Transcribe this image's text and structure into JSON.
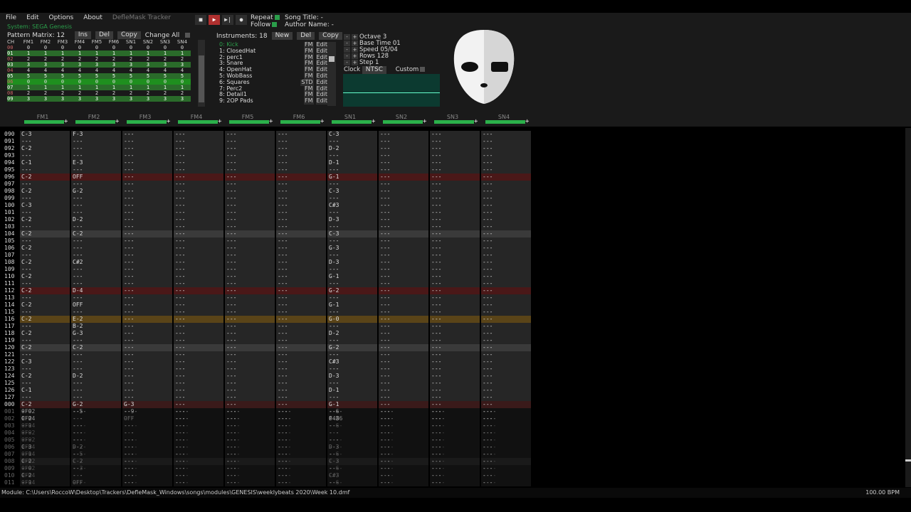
{
  "menu": {
    "items": [
      "File",
      "Edit",
      "Options",
      "About"
    ],
    "app_title": "DefleMask Tracker"
  },
  "system": "System: SEGA Genesis",
  "pattern_matrix": {
    "label": "Pattern Matrix: 12",
    "ins": "Ins",
    "del": "Del",
    "copy": "Copy",
    "change_all": "Change All",
    "channels": [
      "CH",
      "FM1",
      "FM2",
      "FM3",
      "FM4",
      "FM5",
      "FM6",
      "SN1",
      "SN2",
      "SN3",
      "SN4"
    ],
    "rows": [
      [
        "00",
        "0",
        "0",
        "0",
        "0",
        "0",
        "0",
        "0",
        "0",
        "0",
        "0"
      ],
      [
        "01",
        "1",
        "1",
        "1",
        "1",
        "1",
        "1",
        "1",
        "1",
        "1",
        "1"
      ],
      [
        "02",
        "2",
        "2",
        "2",
        "2",
        "2",
        "2",
        "2",
        "2",
        "2",
        "2"
      ],
      [
        "03",
        "3",
        "3",
        "3",
        "3",
        "3",
        "3",
        "3",
        "3",
        "3",
        "3"
      ],
      [
        "04",
        "4",
        "4",
        "4",
        "4",
        "4",
        "4",
        "4",
        "4",
        "4",
        "4"
      ],
      [
        "05",
        "5",
        "5",
        "5",
        "5",
        "5",
        "5",
        "5",
        "5",
        "5",
        "5"
      ],
      [
        "06",
        "0",
        "0",
        "0",
        "0",
        "0",
        "0",
        "0",
        "0",
        "0",
        "0"
      ],
      [
        "07",
        "1",
        "1",
        "1",
        "1",
        "1",
        "1",
        "1",
        "1",
        "1",
        "1"
      ],
      [
        "08",
        "2",
        "2",
        "2",
        "2",
        "2",
        "2",
        "2",
        "2",
        "2",
        "2"
      ],
      [
        "09",
        "3",
        "3",
        "3",
        "3",
        "3",
        "3",
        "3",
        "3",
        "3",
        "3"
      ]
    ]
  },
  "options": {
    "repeat": "Repeat",
    "follow": "Follow"
  },
  "song": {
    "title": "Song Title: -",
    "author": "Author Name: -"
  },
  "instruments": {
    "label": "Instruments: 18",
    "new": "New",
    "del": "Del",
    "copy": "Copy",
    "list": [
      {
        "name": "0: Kick",
        "type": "FM",
        "edit": "Edit"
      },
      {
        "name": "1: ClosedHat",
        "type": "FM",
        "edit": "Edit"
      },
      {
        "name": "2: perc1",
        "type": "FM",
        "edit": "Edit"
      },
      {
        "name": "3: Snare",
        "type": "FM",
        "edit": "Edit"
      },
      {
        "name": "4: OpenHat",
        "type": "FM",
        "edit": "Edit"
      },
      {
        "name": "5: WobBass",
        "type": "FM",
        "edit": "Edit"
      },
      {
        "name": "6: Squares",
        "type": "STD",
        "edit": "Edit"
      },
      {
        "name": "7: Perc2",
        "type": "FM",
        "edit": "Edit"
      },
      {
        "name": "8: Detail1",
        "type": "FM",
        "edit": "Edit"
      },
      {
        "name": "9: 2OP Pads",
        "type": "FM",
        "edit": "Edit"
      }
    ]
  },
  "settings": {
    "octave": "Octave 3",
    "base_time": "Base Time 01",
    "speed": "Speed 05/04",
    "rows": "Rows 128",
    "step": "Step 1",
    "clock": "Clock",
    "ntsc": "NTSC",
    "custom": "Custom"
  },
  "channels": [
    "FM1",
    "FM2",
    "FM3",
    "FM4",
    "FM5",
    "FM6",
    "SN1",
    "SN2",
    "SN3",
    "SN4"
  ],
  "pattern_rows": [
    {
      "r": "090",
      "fm1": "C-3 - 1 0F02",
      "fm2": "F-3 - 7",
      "sn1": "C-3 - 6"
    },
    {
      "r": "091",
      "fm1": "--- - - 0F02",
      "fm2": "",
      "sn1": ""
    },
    {
      "r": "092",
      "fm1": "C-2 - 1 0F04",
      "fm2": "",
      "sn1": "D-2 - 6"
    },
    {
      "r": "093",
      "fm1": "--- - - 0F04",
      "fm2": "",
      "sn1": ""
    },
    {
      "r": "094",
      "fm1": "C-1 - 1 0F02",
      "fm2": "E-3 - 7",
      "sn1": "D-1 - 6"
    },
    {
      "r": "095",
      "fm1": "--- - - 0F02",
      "fm2": "",
      "sn1": ""
    },
    {
      "r": "096",
      "fm1": "C-2 - 0 0F04",
      "fm2": "OFF",
      "sn1": "G-1 - 6",
      "c": "red"
    },
    {
      "r": "097",
      "fm1": "--- - - 0F04",
      "fm2": "",
      "sn1": ""
    },
    {
      "r": "098",
      "fm1": "C-2 - 1 0F02",
      "fm2": "G-2 - 5",
      "sn1": "C-3 - 6"
    },
    {
      "r": "099",
      "fm1": "--- - - 0F02",
      "fm2": "",
      "sn1": ""
    },
    {
      "r": "100",
      "fm1": "C-3 - 1 0F04",
      "fm2": "",
      "sn1": "C#3 - 6"
    },
    {
      "r": "101",
      "fm1": "--- - - 0F04",
      "fm2": "",
      "sn1": ""
    },
    {
      "r": "102",
      "fm1": "C-2 - 1 0F02",
      "fm2": "D-2 - 5",
      "sn1": "D-3 - 6"
    },
    {
      "r": "103",
      "fm1": "--- - - 0F02",
      "fm2": "",
      "sn1": ""
    },
    {
      "r": "104",
      "fm1": "C-2 - 0 0F04",
      "fm2": "C-2 - 3",
      "sn1": "C-3 - 6",
      "c": "gray"
    },
    {
      "r": "105",
      "fm1": "--- - - 0F04",
      "fm2": "",
      "sn1": ""
    },
    {
      "r": "106",
      "fm1": "C-2 - 1 0F02",
      "fm2": "",
      "sn1": "G-3 - 6"
    },
    {
      "r": "107",
      "fm1": "--- - - 0F02",
      "fm2": "",
      "sn1": ""
    },
    {
      "r": "108",
      "fm1": "C-2 - 1 0F04",
      "fm2": "C#2 - 5",
      "sn1": "D-3 - 6"
    },
    {
      "r": "109",
      "fm1": "--- - - 0F04",
      "fm2": "",
      "sn1": ""
    },
    {
      "r": "110",
      "fm1": "C-2 - 0 0F02",
      "fm2": "",
      "sn1": "G-1 - 6"
    },
    {
      "r": "111",
      "fm1": "--- - - 0F02",
      "fm2": "",
      "sn1": ""
    },
    {
      "r": "112",
      "fm1": "C-2 - 1 0F04",
      "fm2": "D-4 - 7",
      "sn1": "G-2 - 6",
      "c": "red"
    },
    {
      "r": "113",
      "fm1": "--- - - 0F04",
      "fm2": "",
      "sn1": ""
    },
    {
      "r": "114",
      "fm1": "C-2 - 1 0F02",
      "fm2": "OFF",
      "sn1": "G-1 - 6"
    },
    {
      "r": "115",
      "fm1": "--- - - 0F02",
      "fm2": "",
      "sn1": ""
    },
    {
      "r": "116",
      "fm1": "C-2 - 0 0F04",
      "fm2": "E-2 - 7",
      "sn1": "G-0 - 6",
      "c": "gold"
    },
    {
      "r": "117",
      "fm1": "--- - - 0F04",
      "fm2": "B-2 - 7",
      "sn1": ""
    },
    {
      "r": "118",
      "fm1": "C-2 - 1 0F02",
      "fm2": "G-3 - 7",
      "sn1": "D-2 - 6"
    },
    {
      "r": "119",
      "fm1": "--- - - 0F02",
      "fm2": "",
      "sn1": ""
    },
    {
      "r": "120",
      "fm1": "C-2 - 0 0F04",
      "fm2": "C-2 - 3",
      "sn1": "G-2 - 6",
      "c": "gray"
    },
    {
      "r": "121",
      "fm1": "--- - - 0F04",
      "fm2": "",
      "sn1": ""
    },
    {
      "r": "122",
      "fm1": "C-3 - 1 0F02",
      "fm2": "",
      "sn1": "C#3 - 6"
    },
    {
      "r": "123",
      "fm1": "--- - - 0F02",
      "fm2": "",
      "sn1": ""
    },
    {
      "r": "124",
      "fm1": "C-2 - 1 0F04",
      "fm2": "D-2 - 5",
      "sn1": "D-3 - 6"
    },
    {
      "r": "125",
      "fm1": "--- - - 0F04",
      "fm2": "",
      "sn1": ""
    },
    {
      "r": "126",
      "fm1": "C-1 - 1 0F02",
      "fm2": "",
      "sn1": "D-1 - 6"
    },
    {
      "r": "127",
      "fm1": "--- - - 0F02",
      "fm2": "",
      "sn1": ""
    },
    {
      "r": "000",
      "fm1": "C-2 - 0 0F04",
      "fm2": "G-2 - 5",
      "fm3": "G-3 - 9",
      "sn1": "G-1 - 6 0486",
      "c": "cur"
    },
    {
      "r": "001",
      "fm1": "--- - - 0F04",
      "fm2": "",
      "sn1": "",
      "f": 1
    },
    {
      "r": "002",
      "fm1": "C-2 - 1 0F02",
      "fm2": "",
      "fm3": "OFF",
      "sn1": "F-3 - 6",
      "f": 1
    },
    {
      "r": "003",
      "fm1": "--- - - 0F02",
      "fm2": "",
      "sn1": "",
      "f": 1
    },
    {
      "r": "004",
      "fm1": "--- - - 0F04",
      "fm2": "",
      "sn1": "",
      "f": 1
    },
    {
      "r": "005",
      "fm1": "--- - - 0F04",
      "fm2": "",
      "sn1": "",
      "f": 1
    },
    {
      "r": "006",
      "fm1": "C-3 - 1 0F02",
      "fm2": "D-2 - 5",
      "sn1": "D-3 - 6",
      "f": 1
    },
    {
      "r": "007",
      "fm1": "--- - - 0F02",
      "fm2": "",
      "sn1": "",
      "f": 1
    },
    {
      "r": "008",
      "fm1": "C-2 - 0 0F04",
      "fm2": "C-2 - 3",
      "sn1": "C-3 - 6",
      "f": 1,
      "c": "gray"
    },
    {
      "r": "009",
      "fm1": "--- - - 0F04",
      "fm2": "",
      "sn1": "",
      "f": 1
    },
    {
      "r": "010",
      "fm1": "C-2 - 1 0F02",
      "fm2": "",
      "sn1": "C#3 - 6",
      "f": 1
    },
    {
      "r": "011",
      "fm1": "--- - - 0F02",
      "fm2": "OFF",
      "sn1": "",
      "f": 1
    }
  ],
  "status": {
    "path": "Module: C:\\Users\\RoccoW\\Desktop\\Trackers\\DefleMask_Windows\\songs\\modules\\GENESIS\\weeklybeats 2020\\Week 10.dmf",
    "bpm": "100.00 BPM"
  }
}
